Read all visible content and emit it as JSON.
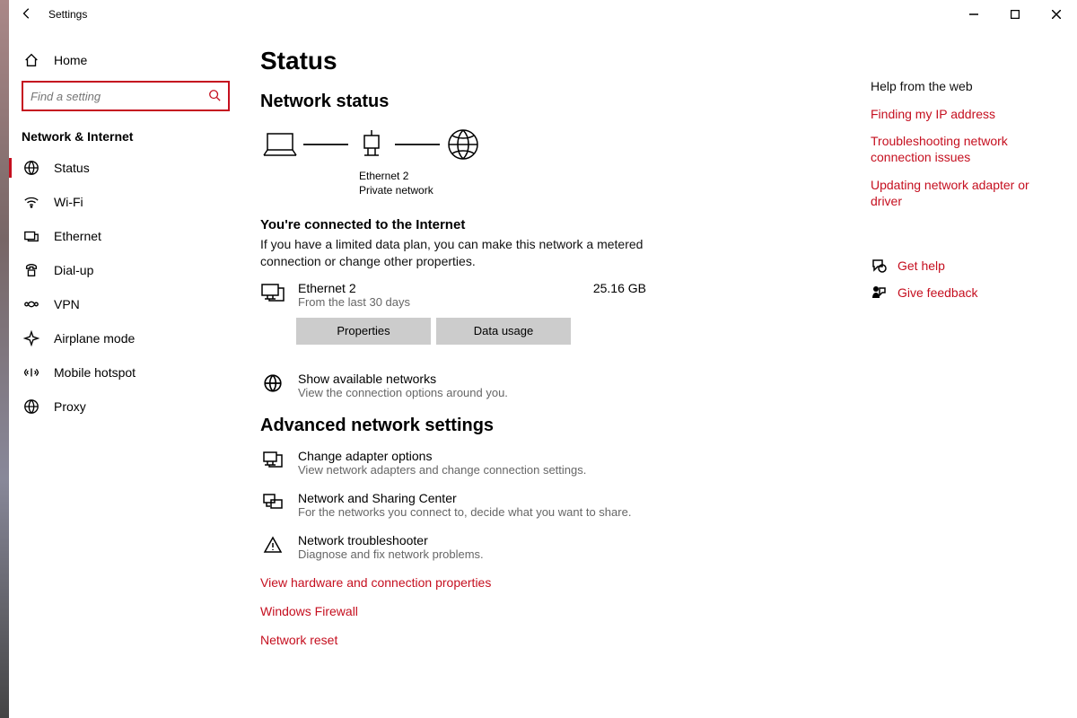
{
  "window": {
    "title": "Settings"
  },
  "sidebar": {
    "home": "Home",
    "search_placeholder": "Find a setting",
    "section": "Network & Internet",
    "items": [
      {
        "label": "Status"
      },
      {
        "label": "Wi-Fi"
      },
      {
        "label": "Ethernet"
      },
      {
        "label": "Dial-up"
      },
      {
        "label": "VPN"
      },
      {
        "label": "Airplane mode"
      },
      {
        "label": "Mobile hotspot"
      },
      {
        "label": "Proxy"
      }
    ]
  },
  "main": {
    "title": "Status",
    "network_status_heading": "Network status",
    "diagram": {
      "name": "Ethernet 2",
      "type": "Private network"
    },
    "connected_heading": "You're connected to the Internet",
    "connected_desc": "If you have a limited data plan, you can make this network a metered connection or change other properties.",
    "connection": {
      "name": "Ethernet 2",
      "sub": "From the last 30 days",
      "usage": "25.16 GB"
    },
    "buttons": {
      "properties": "Properties",
      "data_usage": "Data usage"
    },
    "show_networks": {
      "name": "Show available networks",
      "sub": "View the connection options around you."
    },
    "advanced_heading": "Advanced network settings",
    "adv_items": [
      {
        "name": "Change adapter options",
        "sub": "View network adapters and change connection settings."
      },
      {
        "name": "Network and Sharing Center",
        "sub": "For the networks you connect to, decide what you want to share."
      },
      {
        "name": "Network troubleshooter",
        "sub": "Diagnose and fix network problems."
      }
    ],
    "links": [
      "View hardware and connection properties",
      "Windows Firewall",
      "Network reset"
    ]
  },
  "right": {
    "heading": "Help from the web",
    "help_links": [
      "Finding my IP address",
      "Troubleshooting network connection issues",
      "Updating network adapter or driver"
    ],
    "get_help": "Get help",
    "give_feedback": "Give feedback"
  }
}
